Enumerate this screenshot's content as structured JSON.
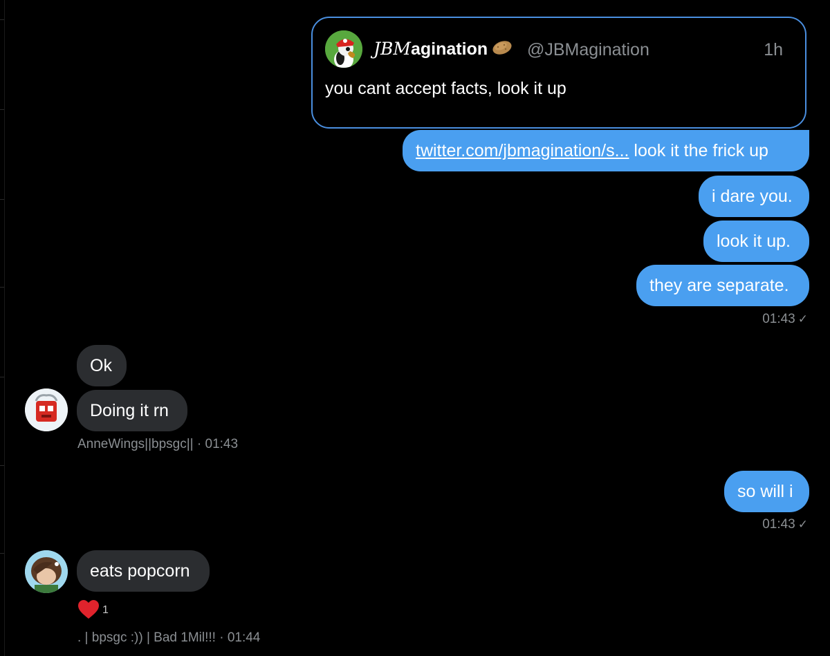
{
  "quote": {
    "name_styled": "JBM",
    "name_rest": "agination",
    "handle": "@JBMagination",
    "time": "1h",
    "text": "you cant accept facts, look it up",
    "avatar_icon": "mario-duck-avatar",
    "emoji_icon": "potato-emoji"
  },
  "messages": {
    "m1_link": "twitter.com/jbmagination/s...",
    "m1_text": " look it the frick up",
    "m2": "i dare you.",
    "m3": "look it up.",
    "m4": "they are separate.",
    "time1": "01:43",
    "anne1": "Ok",
    "anne2": "Doing it rn",
    "anne_sender": "AnneWings||bpsgc||",
    "anne_time": "· 01:43",
    "m5": "so will i",
    "time2": "01:43",
    "bad1": "eats popcorn",
    "reaction_count": "1",
    "bad_sender": ". | bpsgc :)) | Bad 1Mil!!!",
    "bad_time": "· 01:44",
    "check": "✓"
  },
  "colors": {
    "outgoing_bubble": "#4a9ff0",
    "incoming_bubble": "#2b2d30",
    "quote_border": "#4a8fe0",
    "meta_text": "#8b8f93"
  }
}
